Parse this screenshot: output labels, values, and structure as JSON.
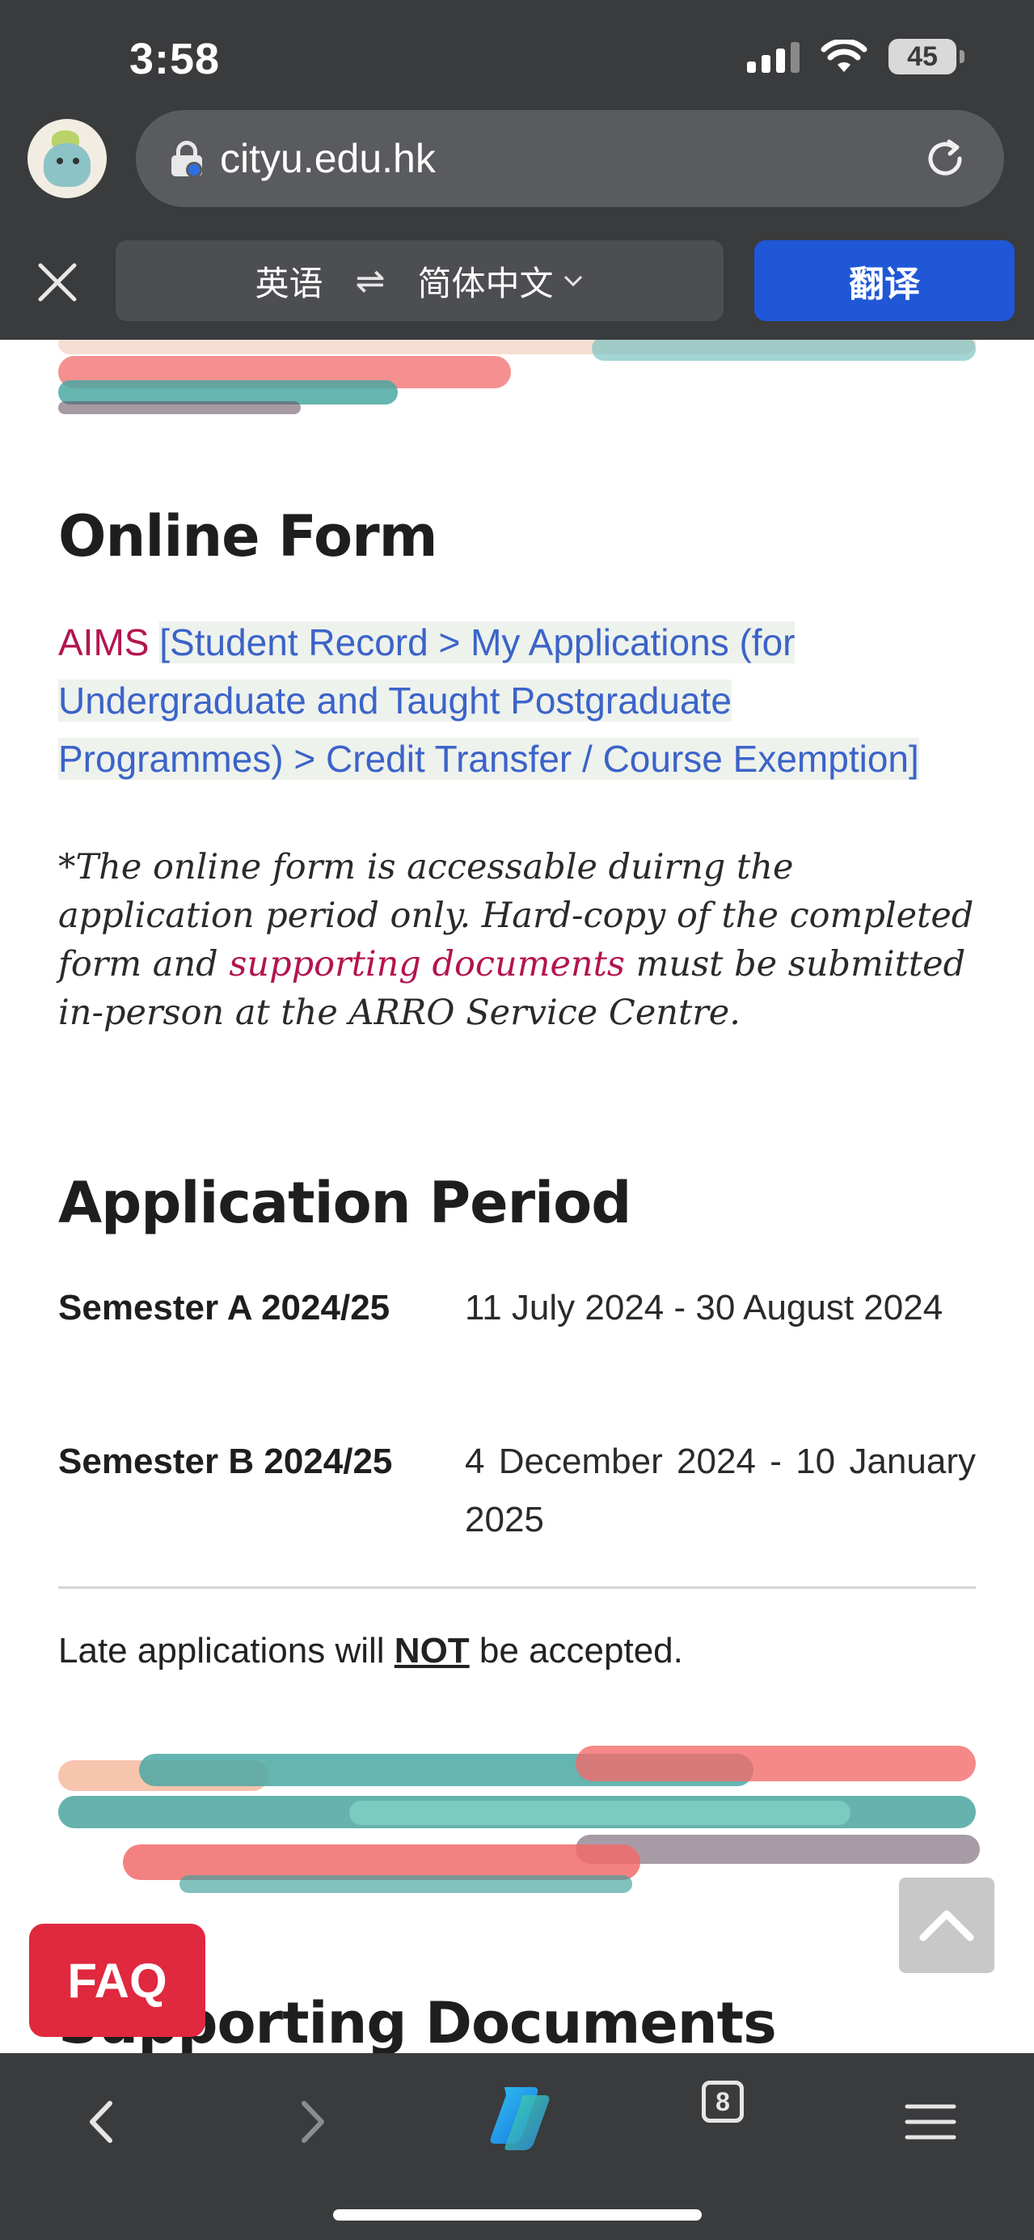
{
  "status_bar": {
    "time": "3:58",
    "battery": "45"
  },
  "browser": {
    "url": "cityu.edu.hk",
    "translate_bar": {
      "source_lang": "英语",
      "swap_symbol": "⇌",
      "target_lang": "简体中文",
      "translate_label": "翻译"
    },
    "toolbar": {
      "tab_count": "8"
    }
  },
  "page": {
    "online_form": {
      "heading": "Online Form",
      "aims_label": "AIMS",
      "aims_path": "[Student Record > My Applications (for Undergraduate and Taught Postgraduate Programmes) > Credit Transfer / Course Exemption]",
      "note_part1": "*The online form is accessable duirng the application period only. Hard-copy of the completed form and ",
      "note_link": "supporting documents",
      "note_part2": " must be submitted in-person at the ARRO Service Centre."
    },
    "application_period": {
      "heading": "Application Period",
      "rows": [
        {
          "semester": "Semester A 2024/25",
          "dates": "11 July 2024 - 30 August 2024"
        },
        {
          "semester": "Semester B 2024/25",
          "dates": "4 December 2024 - 10 January 2025"
        }
      ],
      "late_prefix": "Late applications will ",
      "late_emphasis": "NOT",
      "late_suffix": " be accepted."
    },
    "next_section_heading": "Supporting Documents",
    "faq_label": "FAQ"
  },
  "colors": {
    "accent_link": "#3b63c9",
    "brand_red": "#b3144f",
    "faq_red": "#e0283f",
    "translate_blue": "#1f57d6"
  }
}
